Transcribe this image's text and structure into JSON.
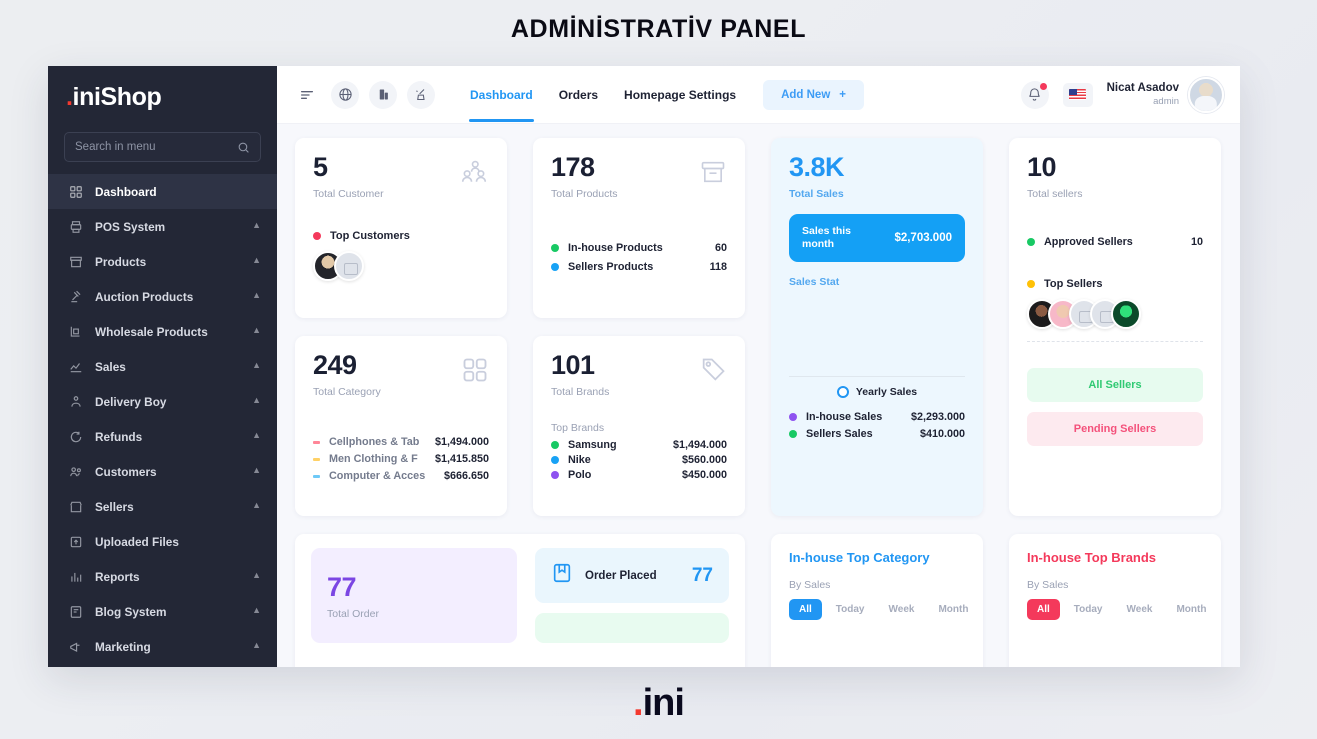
{
  "slide": {
    "title": "ADMİNİSTRATİV PANEL",
    "footer_logo_dot": ".",
    "footer_logo_text": "ini"
  },
  "sidebar": {
    "brand_dot": ".",
    "brand_text": "iniShop",
    "search_placeholder": "Search in menu",
    "search_value": "",
    "items": [
      {
        "label": "Dashboard",
        "icon": "grid-icon",
        "caret": false,
        "active": true
      },
      {
        "label": "POS System",
        "icon": "printer-icon",
        "caret": true,
        "active": false
      },
      {
        "label": "Products",
        "icon": "box-icon",
        "caret": true,
        "active": false
      },
      {
        "label": "Auction Products",
        "caret": true,
        "icon": "gavel-icon",
        "active": false
      },
      {
        "label": "Wholesale Products",
        "caret": true,
        "icon": "cart-icon",
        "active": false
      },
      {
        "label": "Sales",
        "caret": true,
        "icon": "chart-icon",
        "active": false
      },
      {
        "label": "Delivery Boy",
        "caret": true,
        "icon": "delivery-icon",
        "active": false
      },
      {
        "label": "Refunds",
        "caret": true,
        "icon": "refund-icon",
        "active": false
      },
      {
        "label": "Customers",
        "caret": true,
        "icon": "users-icon",
        "active": false
      },
      {
        "label": "Sellers",
        "caret": true,
        "icon": "store-icon",
        "active": false
      },
      {
        "label": "Uploaded Files",
        "caret": false,
        "icon": "upload-icon",
        "active": false
      },
      {
        "label": "Reports",
        "caret": true,
        "icon": "bar-chart-icon",
        "active": false
      },
      {
        "label": "Blog System",
        "caret": true,
        "icon": "blog-icon",
        "active": false
      },
      {
        "label": "Marketing",
        "caret": true,
        "icon": "megaphone-icon",
        "active": false
      }
    ]
  },
  "topbar": {
    "icons": [
      "menu-icon",
      "globe-icon",
      "store-icon",
      "broom-icon"
    ],
    "nav": [
      {
        "label": "Dashboard",
        "active": true
      },
      {
        "label": "Orders",
        "active": false
      },
      {
        "label": "Homepage Settings",
        "active": false
      }
    ],
    "add_new_label": "Add New",
    "add_new_plus": "+",
    "user_name": "Nicat Asadov",
    "user_role": "admin"
  },
  "cards": {
    "total_customer": {
      "value": "5",
      "label": "Total Customer",
      "legend_label": "Top Customers",
      "legend_color": "#f4395b",
      "avatars": 2
    },
    "total_products": {
      "value": "178",
      "label": "Total Products",
      "rows": [
        {
          "name": "In-house Products",
          "value": "60",
          "color": "#18c964"
        },
        {
          "name": "Sellers Products",
          "value": "118",
          "color": "#18a2f5"
        }
      ]
    },
    "total_sales": {
      "value": "3.8K",
      "label": "Total Sales",
      "pill_label": "Sales this month",
      "pill_value": "$2,703.000",
      "stat_label": "Sales Stat",
      "chart_legend": "Yearly Sales",
      "rows": [
        {
          "name": "In-house Sales",
          "value": "$2,293.000",
          "color": "#8e52f0"
        },
        {
          "name": "Sellers Sales",
          "value": "$410.000",
          "color": "#18c964"
        }
      ]
    },
    "total_sellers": {
      "value": "10",
      "label": "Total sellers",
      "rows": [
        {
          "name": "Approved Sellers",
          "value": "10",
          "color": "#18c964"
        }
      ],
      "top_sellers_label": "Top Sellers",
      "top_sellers_color": "#ffc107",
      "avatars": 5,
      "all_sellers_btn": "All Sellers",
      "pending_sellers_btn": "Pending Sellers"
    },
    "total_category": {
      "value": "249",
      "label": "Total Category",
      "rows": [
        {
          "name": "Cellphones & Tab",
          "value": "$1,494.000",
          "color": "#ff8698"
        },
        {
          "name": "Men Clothing & F",
          "value": "$1,415.850",
          "color": "#ffd166"
        },
        {
          "name": "Computer & Acces",
          "value": "$666.650",
          "color": "#6ec9f7"
        }
      ]
    },
    "total_brands": {
      "value": "101",
      "label": "Total Brands",
      "top_label": "Top Brands",
      "rows": [
        {
          "name": "Samsung",
          "value": "$1,494.000",
          "color": "#18c964"
        },
        {
          "name": "Nike",
          "value": "$560.000",
          "color": "#18a2f5"
        },
        {
          "name": "Polo",
          "value": "$450.000",
          "color": "#8e52f0"
        }
      ]
    },
    "total_order": {
      "value": "77",
      "label": "Total Order",
      "order_placed_label": "Order Placed",
      "order_placed_value": "77"
    },
    "inhouse_top_category": {
      "title": "In-house Top Category",
      "by_label": "By Sales",
      "chips": [
        "All",
        "Today",
        "Week",
        "Month"
      ],
      "active_chip": "All",
      "accent": "#2196f3"
    },
    "inhouse_top_brands": {
      "title": "In-house Top Brands",
      "by_label": "By Sales",
      "chips": [
        "All",
        "Today",
        "Week",
        "Month"
      ],
      "active_chip": "All",
      "accent": "#f4395b"
    }
  }
}
